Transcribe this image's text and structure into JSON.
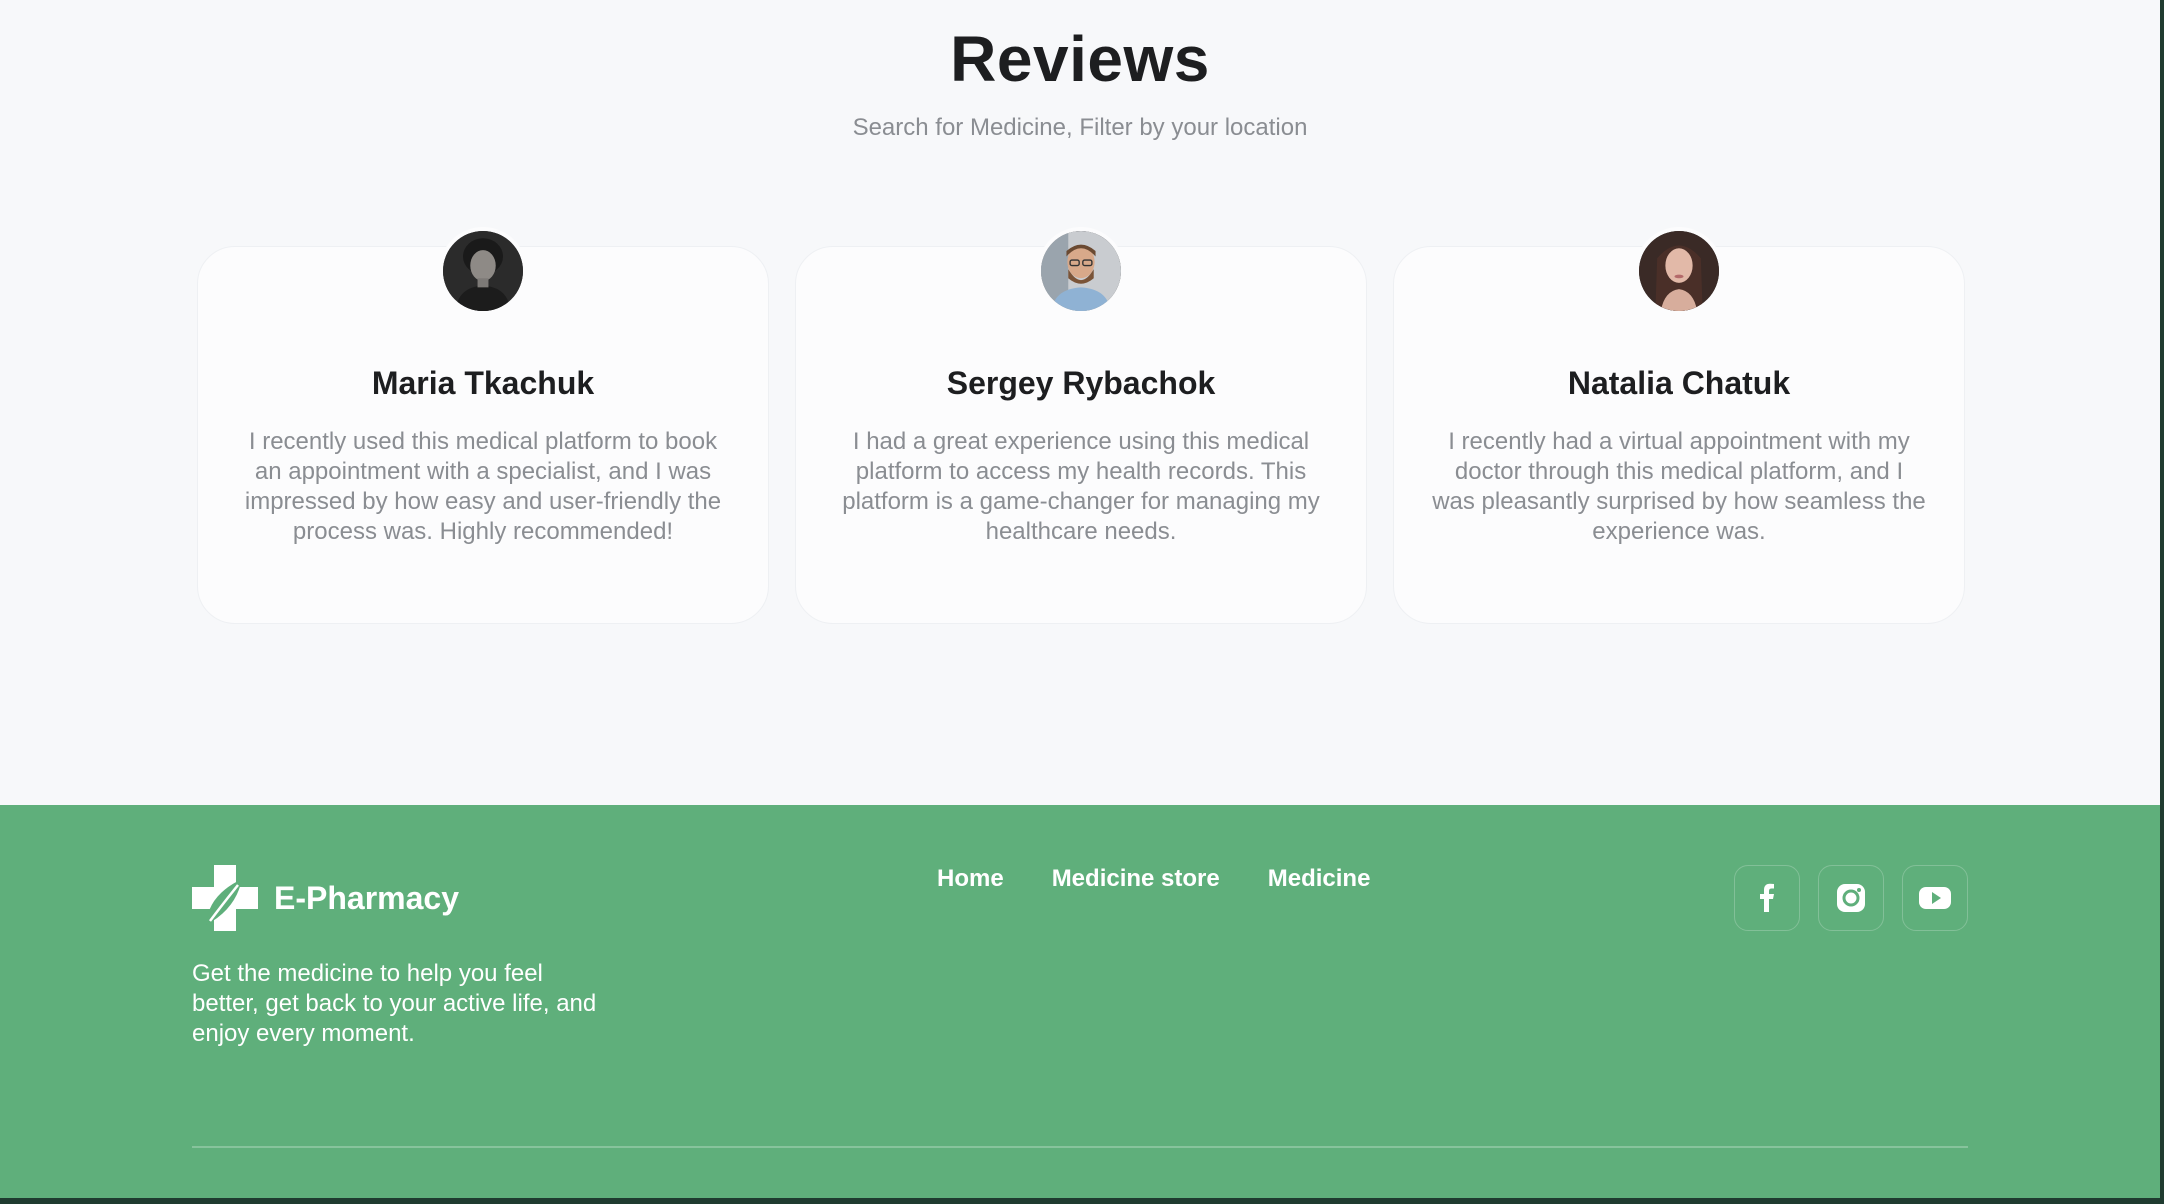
{
  "reviews": {
    "title": "Reviews",
    "subtitle": "Search for Medicine, Filter by your location",
    "items": [
      {
        "name": "Maria Tkachuk",
        "text": "I recently used this medical platform to book an appointment with a specialist, and I was impressed by how easy and user-friendly the process was. Highly recommended!"
      },
      {
        "name": "Sergey Rybachok",
        "text": "I had a great experience using this medical platform to access my health records. This platform is a game-changer for managing my healthcare needs."
      },
      {
        "name": "Natalia Chatuk",
        "text": "I recently had a virtual appointment with my doctor through this medical platform, and I was pleasantly surprised by how seamless the experience was."
      }
    ]
  },
  "footer": {
    "brand": "E-Pharmacy",
    "tagline": "Get the medicine to help you feel better, get back to your active life, and enjoy every moment.",
    "nav": [
      "Home",
      "Medicine store",
      "Medicine"
    ],
    "socials": [
      "facebook-icon",
      "instagram-icon",
      "youtube-icon"
    ]
  },
  "colors": {
    "footer_bg": "#5faf7b",
    "page_bg": "#f7f8fa",
    "heading": "#1d1e20",
    "muted_text": "#8a8d92"
  }
}
